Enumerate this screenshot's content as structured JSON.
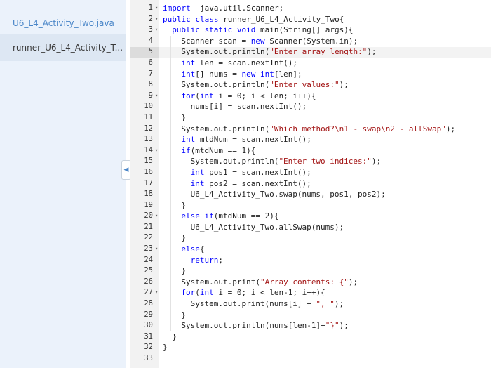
{
  "sidebar": {
    "files": [
      "U6_L4_Activity_Two.java",
      "runner_U6_L4_Activity_T..."
    ],
    "active_index": 1,
    "collapse_glyph": "◀"
  },
  "editor": {
    "active_line": 5,
    "fold_glyph": "▾",
    "lines": [
      {
        "n": "1",
        "fold": true,
        "indent": 0,
        "tokens": [
          [
            "kw",
            "import"
          ],
          [
            "",
            "  java.util.Scanner;"
          ]
        ]
      },
      {
        "n": "2",
        "fold": true,
        "indent": 0,
        "tokens": [
          [
            "kw",
            "public"
          ],
          [
            "",
            " "
          ],
          [
            "kw",
            "class"
          ],
          [
            "",
            " runner_U6_L4_Activity_Two{"
          ]
        ]
      },
      {
        "n": "3",
        "fold": true,
        "indent": 1,
        "tokens": [
          [
            "kw",
            "public"
          ],
          [
            "",
            " "
          ],
          [
            "kw",
            "static"
          ],
          [
            "",
            " "
          ],
          [
            "kw",
            "void"
          ],
          [
            "",
            " main(String[] args){"
          ]
        ]
      },
      {
        "n": "4",
        "fold": false,
        "indent": 2,
        "tokens": [
          [
            "",
            "Scanner scan = "
          ],
          [
            "kw",
            "new"
          ],
          [
            "",
            " Scanner(System.in);"
          ]
        ]
      },
      {
        "n": "5",
        "fold": false,
        "indent": 2,
        "tokens": [
          [
            "",
            "System.out.println("
          ],
          [
            "str",
            "\"Enter array length:\""
          ],
          [
            "",
            ");"
          ]
        ]
      },
      {
        "n": "6",
        "fold": false,
        "indent": 2,
        "tokens": [
          [
            "kw",
            "int"
          ],
          [
            "",
            " len = scan.nextInt();"
          ]
        ]
      },
      {
        "n": "7",
        "fold": false,
        "indent": 2,
        "tokens": [
          [
            "kw",
            "int"
          ],
          [
            "",
            "[] nums = "
          ],
          [
            "kw",
            "new"
          ],
          [
            "",
            " "
          ],
          [
            "kw",
            "int"
          ],
          [
            "",
            "[len];"
          ]
        ]
      },
      {
        "n": "8",
        "fold": false,
        "indent": 2,
        "tokens": [
          [
            "",
            "System.out.println("
          ],
          [
            "str",
            "\"Enter values:\""
          ],
          [
            "",
            ");"
          ]
        ]
      },
      {
        "n": "9",
        "fold": true,
        "indent": 2,
        "tokens": [
          [
            "kw",
            "for"
          ],
          [
            "",
            "("
          ],
          [
            "kw",
            "int"
          ],
          [
            "",
            " i = 0; i < len; i++){"
          ]
        ]
      },
      {
        "n": "10",
        "fold": false,
        "indent": 3,
        "tokens": [
          [
            "",
            "nums[i] = scan.nextInt();"
          ]
        ]
      },
      {
        "n": "11",
        "fold": false,
        "indent": 2,
        "tokens": [
          [
            "",
            "}"
          ]
        ]
      },
      {
        "n": "12",
        "fold": false,
        "indent": 2,
        "tokens": [
          [
            "",
            "System.out.println("
          ],
          [
            "str",
            "\"Which method?\\n1 - swap\\n2 - allSwap\""
          ],
          [
            "",
            ");"
          ]
        ]
      },
      {
        "n": "13",
        "fold": false,
        "indent": 2,
        "tokens": [
          [
            "kw",
            "int"
          ],
          [
            "",
            " mtdNum = scan.nextInt();"
          ]
        ]
      },
      {
        "n": "14",
        "fold": true,
        "indent": 2,
        "tokens": [
          [
            "kw",
            "if"
          ],
          [
            "",
            "(mtdNum == 1){"
          ]
        ]
      },
      {
        "n": "15",
        "fold": false,
        "indent": 3,
        "tokens": [
          [
            "",
            "System.out.println("
          ],
          [
            "str",
            "\"Enter two indices:\""
          ],
          [
            "",
            ");"
          ]
        ]
      },
      {
        "n": "16",
        "fold": false,
        "indent": 3,
        "tokens": [
          [
            "kw",
            "int"
          ],
          [
            "",
            " pos1 = scan.nextInt();"
          ]
        ]
      },
      {
        "n": "17",
        "fold": false,
        "indent": 3,
        "tokens": [
          [
            "kw",
            "int"
          ],
          [
            "",
            " pos2 = scan.nextInt();"
          ]
        ]
      },
      {
        "n": "18",
        "fold": false,
        "indent": 3,
        "tokens": [
          [
            "",
            "U6_L4_Activity_Two.swap(nums, pos1, pos2);"
          ]
        ]
      },
      {
        "n": "19",
        "fold": false,
        "indent": 2,
        "tokens": [
          [
            "",
            "}"
          ]
        ]
      },
      {
        "n": "20",
        "fold": true,
        "indent": 2,
        "tokens": [
          [
            "kw",
            "else"
          ],
          [
            "",
            " "
          ],
          [
            "kw",
            "if"
          ],
          [
            "",
            "(mtdNum == 2){"
          ]
        ]
      },
      {
        "n": "21",
        "fold": false,
        "indent": 3,
        "tokens": [
          [
            "",
            "U6_L4_Activity_Two.allSwap(nums);"
          ]
        ]
      },
      {
        "n": "22",
        "fold": false,
        "indent": 2,
        "tokens": [
          [
            "",
            "}"
          ]
        ]
      },
      {
        "n": "23",
        "fold": true,
        "indent": 2,
        "tokens": [
          [
            "kw",
            "else"
          ],
          [
            "",
            "{"
          ]
        ]
      },
      {
        "n": "24",
        "fold": false,
        "indent": 3,
        "tokens": [
          [
            "kw",
            "return"
          ],
          [
            "",
            ";"
          ]
        ]
      },
      {
        "n": "25",
        "fold": false,
        "indent": 2,
        "tokens": [
          [
            "",
            "}"
          ]
        ]
      },
      {
        "n": "26",
        "fold": false,
        "indent": 2,
        "tokens": [
          [
            "",
            "System.out.print("
          ],
          [
            "str",
            "\"Array contents: {\""
          ],
          [
            "",
            ");"
          ]
        ]
      },
      {
        "n": "27",
        "fold": true,
        "indent": 2,
        "tokens": [
          [
            "kw",
            "for"
          ],
          [
            "",
            "("
          ],
          [
            "kw",
            "int"
          ],
          [
            "",
            " i = 0; i < len-1; i++){"
          ]
        ]
      },
      {
        "n": "28",
        "fold": false,
        "indent": 3,
        "tokens": [
          [
            "",
            "System.out.print(nums[i] + "
          ],
          [
            "str",
            "\", \""
          ],
          [
            "",
            ");"
          ]
        ]
      },
      {
        "n": "29",
        "fold": false,
        "indent": 2,
        "tokens": [
          [
            "",
            "}"
          ]
        ]
      },
      {
        "n": "30",
        "fold": false,
        "indent": 2,
        "tokens": [
          [
            "",
            "System.out.println(nums[len-1]+"
          ],
          [
            "str",
            "\"}\""
          ],
          [
            "",
            ");"
          ]
        ]
      },
      {
        "n": "31",
        "fold": false,
        "indent": 1,
        "tokens": [
          [
            "",
            "}"
          ]
        ]
      },
      {
        "n": "32",
        "fold": false,
        "indent": 0,
        "tokens": [
          [
            "",
            "}"
          ]
        ]
      },
      {
        "n": "33",
        "fold": false,
        "indent": 0,
        "tokens": []
      }
    ]
  }
}
